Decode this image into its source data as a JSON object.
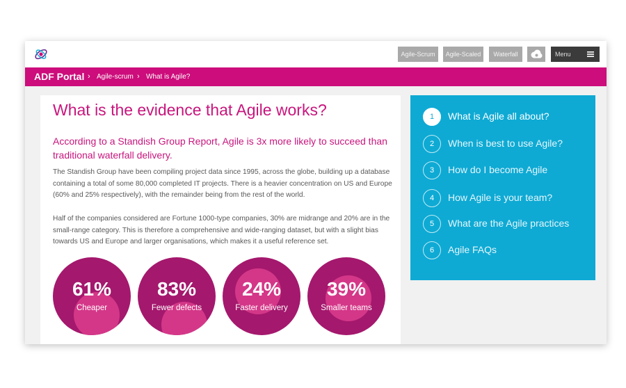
{
  "nav": {
    "buttons": [
      "Agile-Scrum",
      "Agile-Scaled",
      "Waterfall"
    ],
    "menu_label": "Menu",
    "cloud_icon": "cloud-icon",
    "menu_icon": "hamburger-icon"
  },
  "breadcrumb": {
    "brand": "ADF Portal",
    "items": [
      "Agile-scrum",
      "What is Agile?"
    ]
  },
  "article": {
    "title": "What is the evidence that Agile works?",
    "subtitle": "According to a Standish Group Report, Agile is 3x more likely to succeed than traditional waterfall delivery.",
    "paragraphs": [
      "The Standish Group have been compiling project data since 1995, across the globe, building up a database containing a total of some 80,000 completed IT projects. There is a heavier concentration on US and Europe (60% and 25% respectively), with the remainder being from the rest of the world.",
      "Half of the companies considered are Fortune 1000-type companies, 30% are midrange and 20% are in the small-range category. This is therefore a comprehensive and wide-ranging dataset, but with a slight bias towards US and Europe and larger organisations, which makes it a useful reference set."
    ],
    "stats": [
      {
        "value": "61%",
        "label": "Cheaper"
      },
      {
        "value": "83%",
        "label": "Fewer defects"
      },
      {
        "value": "24%",
        "label": "Faster delivery"
      },
      {
        "value": "39%",
        "label": "Smaller teams"
      }
    ]
  },
  "sidebar": {
    "items": [
      {
        "number": "1",
        "label": "What is Agile all about?"
      },
      {
        "number": "2",
        "label": "When is best to use Agile?"
      },
      {
        "number": "3",
        "label": "How do I become Agile"
      },
      {
        "number": "4",
        "label": "How Agile is your team?"
      },
      {
        "number": "5",
        "label": "What are the Agile practices"
      },
      {
        "number": "6",
        "label": "Agile FAQs"
      }
    ]
  },
  "colors": {
    "accent": "#cc0d7b",
    "sidebar": "#0eaad4",
    "stat_outer": "#a4186d",
    "stat_inner": "#d43788"
  }
}
